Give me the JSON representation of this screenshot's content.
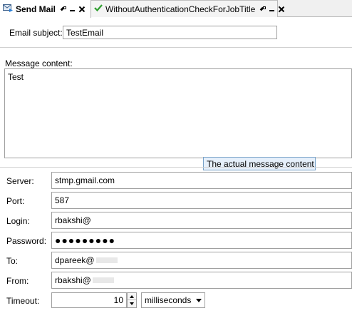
{
  "tabs": [
    {
      "label": "Send Mail",
      "icon": "mail-send-icon",
      "active": true
    },
    {
      "label": "WithoutAuthenticationCheckForJobTitle",
      "icon": "check-icon",
      "active": false
    }
  ],
  "subject": {
    "label": "Email subject:",
    "value": "TestEmail"
  },
  "message": {
    "label": "Message content:",
    "value": "Test",
    "tooltip": "The actual message content"
  },
  "fields": {
    "server": {
      "label": "Server:",
      "value": "stmp.gmail.com"
    },
    "port": {
      "label": "Port:",
      "value": "587"
    },
    "login": {
      "label": "Login:",
      "value": "rbakshi@"
    },
    "password": {
      "label": "Password:",
      "value": "●●●●●●●●●"
    },
    "to": {
      "label": "To:",
      "value": "dpareek@"
    },
    "from": {
      "label": "From:",
      "value": "rbakshi@"
    },
    "timeout": {
      "label": "Timeout:",
      "value": "10",
      "unit": "milliseconds"
    }
  },
  "colors": {
    "check": "#2e9e2e",
    "tooltip_bg": "#e6f0fb"
  }
}
